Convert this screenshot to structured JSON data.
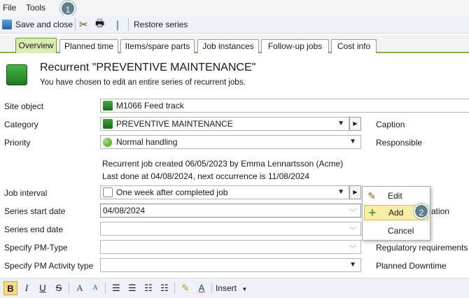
{
  "menu": {
    "file": "File",
    "tools": "Tools"
  },
  "toolbar": {
    "save_close": "Save and close",
    "restore_series": "Restore series"
  },
  "callouts": {
    "one": "1",
    "two": "2"
  },
  "tabs": [
    "Overview",
    "Planned time",
    "Items/spare parts",
    "Job instances",
    "Follow-up jobs",
    "Cost info"
  ],
  "header": {
    "title": "Recurrent \"PREVENTIVE MAINTENANCE\"",
    "subtitle": "You have chosen to edit an entire series of recurrent jobs."
  },
  "form": {
    "site_object": {
      "label": "Site object",
      "value": "M1066  Feed track"
    },
    "category": {
      "label": "Category",
      "value": "PREVENTIVE MAINTENANCE"
    },
    "priority": {
      "label": "Priority",
      "value": "Normal handling"
    },
    "info_line1": "Recurrent job created 06/05/2023 by Emma Lennartsson (Acme)",
    "info_line2": "Last done at 04/08/2024, next occurrence is 11/08/2024",
    "job_interval": {
      "label": "Job interval",
      "value": "One week after completed job"
    },
    "series_start": {
      "label": "Series start date",
      "value": "04/08/2024"
    },
    "series_end": {
      "label": "Series end date",
      "value": ""
    },
    "pm_type": {
      "label": "Specify PM-Type",
      "value": ""
    },
    "pm_activity": {
      "label": "Specify PM Activity type",
      "value": ""
    }
  },
  "right_labels": {
    "caption": "Caption",
    "responsible": "Responsible",
    "partial": "ation",
    "regulatory": "Regulatory requirements",
    "downtime": "Planned Downtime"
  },
  "popup": {
    "edit": "Edit",
    "add": "Add",
    "cancel": "Cancel"
  },
  "editor": {
    "bold": "B",
    "italic": "I",
    "underline": "U",
    "strike": "S",
    "insert": "Insert"
  },
  "colors": {
    "accent_green": "#7fb24a",
    "active_tab": "#d9ecb4",
    "callout": "#5d7e8a",
    "highlight": "#f8eda5"
  }
}
